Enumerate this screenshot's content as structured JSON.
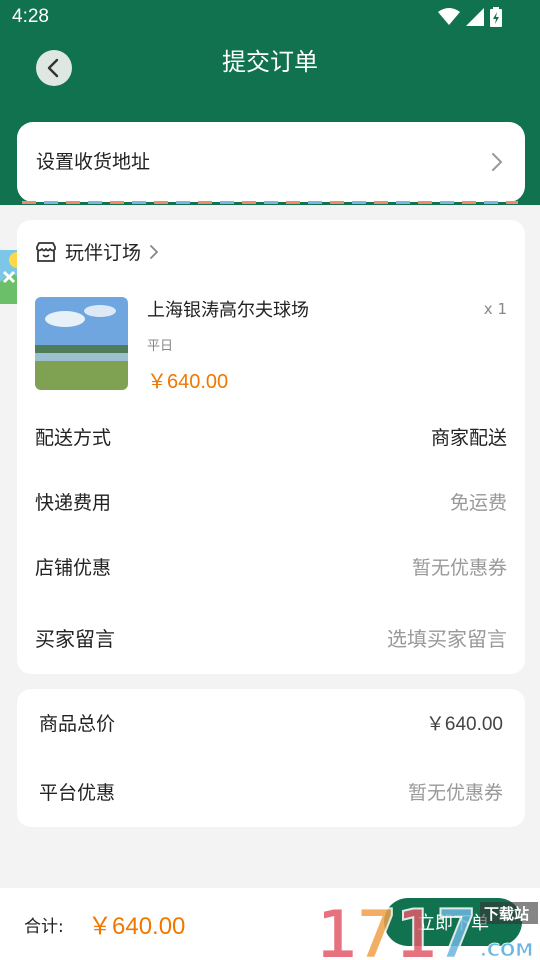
{
  "status_bar": {
    "time": "4:28"
  },
  "header": {
    "title": "提交订单"
  },
  "address": {
    "label": "设置收货地址"
  },
  "shop": {
    "name": "玩伴订场"
  },
  "product": {
    "name": "上海银涛高尔夫球场",
    "quantity": "x 1",
    "spec": "平日",
    "price": "￥640.00"
  },
  "order_rows": [
    {
      "label": "配送方式",
      "value": "商家配送"
    },
    {
      "label": "快递费用",
      "value": "免运费"
    },
    {
      "label": "店铺优惠",
      "value": "暂无优惠券"
    },
    {
      "label": "买家留言",
      "value": "选填买家留言"
    }
  ],
  "summary_rows": [
    {
      "label": "商品总价",
      "value": "￥640.00"
    },
    {
      "label": "平台优惠",
      "value": "暂无优惠券"
    }
  ],
  "bottom_bar": {
    "total_label": "合计:",
    "total_value": "￥640.00",
    "submit_label": "立即下单"
  },
  "watermark": {
    "text": "1717",
    "sub": "下载站",
    "domain": ".COM"
  },
  "colors": {
    "brand_green": "#117250",
    "price_orange": "#f07800"
  }
}
